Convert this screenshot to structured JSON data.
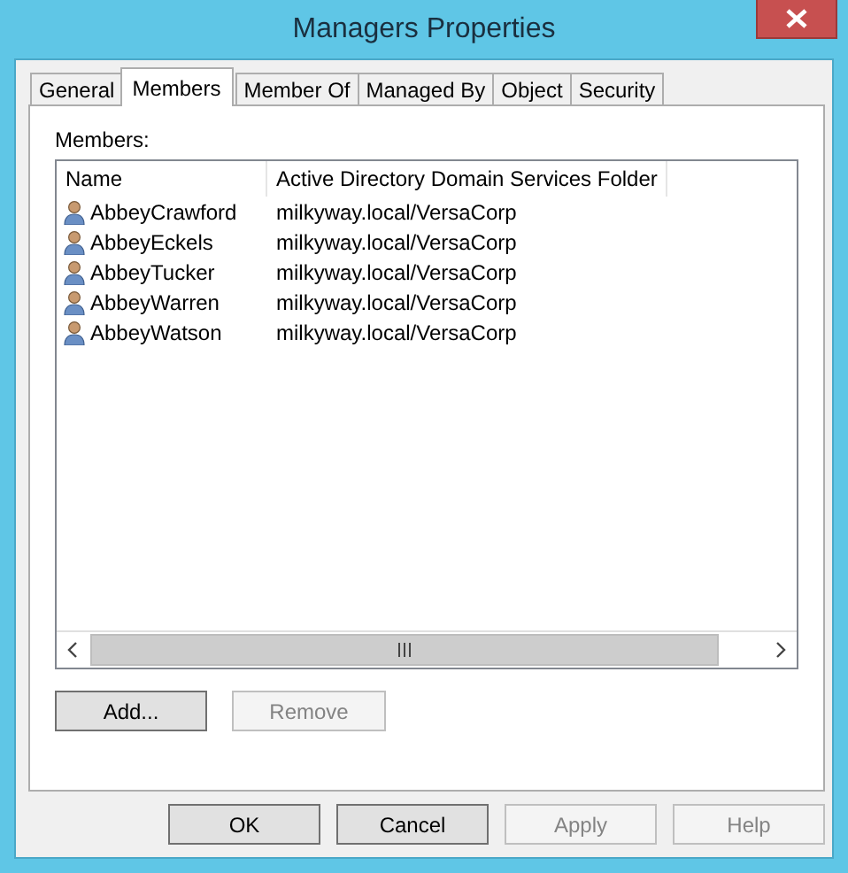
{
  "window": {
    "title": "Managers Properties"
  },
  "tabs": [
    {
      "label": "General",
      "selected": false
    },
    {
      "label": "Members",
      "selected": true
    },
    {
      "label": "Member Of",
      "selected": false
    },
    {
      "label": "Managed By",
      "selected": false
    },
    {
      "label": "Object",
      "selected": false
    },
    {
      "label": "Security",
      "selected": false
    }
  ],
  "members": {
    "label": "Members:",
    "columns": [
      "Name",
      "Active Directory Domain Services Folder"
    ],
    "rows": [
      {
        "name": "AbbeyCrawford",
        "folder": "milkyway.local/VersaCorp"
      },
      {
        "name": "AbbeyEckels",
        "folder": "milkyway.local/VersaCorp"
      },
      {
        "name": "AbbeyTucker",
        "folder": "milkyway.local/VersaCorp"
      },
      {
        "name": "AbbeyWarren",
        "folder": "milkyway.local/VersaCorp"
      },
      {
        "name": "AbbeyWatson",
        "folder": "milkyway.local/VersaCorp"
      }
    ]
  },
  "list_buttons": [
    {
      "label": "Add...",
      "disabled": false
    },
    {
      "label": "Remove",
      "disabled": true
    }
  ],
  "buttons": [
    {
      "label": "OK",
      "disabled": false
    },
    {
      "label": "Cancel",
      "disabled": false
    },
    {
      "label": "Apply",
      "disabled": true
    },
    {
      "label": "Help",
      "disabled": true
    }
  ]
}
